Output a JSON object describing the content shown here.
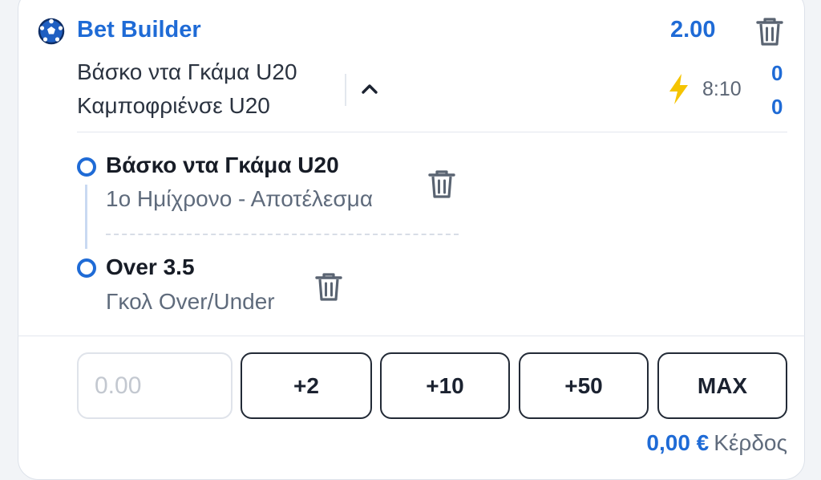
{
  "header": {
    "title": "Bet Builder",
    "odds": "2.00"
  },
  "match": {
    "home_team": "Βάσκο ντα Γκάμα U20",
    "away_team": "Καμποφριένσε U20",
    "clock": "8:10",
    "home_score": "0",
    "away_score": "0"
  },
  "selections": [
    {
      "name": "Βάσκο ντα Γκάμα U20",
      "market": "1ο Ημίχρονο - Αποτέλεσμα"
    },
    {
      "name": "Over 3.5",
      "market": "Γκολ Over/Under"
    }
  ],
  "stake": {
    "placeholder": "0.00",
    "quick_buttons": [
      "+2",
      "+10",
      "+50",
      "MAX"
    ]
  },
  "payout": {
    "value": "0,00 €",
    "label": "Κέρδος"
  },
  "colors": {
    "accent": "#1f6bd6",
    "live_bolt": "#f5c400"
  },
  "icons": [
    "football-icon",
    "trash-icon",
    "chevron-up-icon",
    "lightning-icon"
  ]
}
